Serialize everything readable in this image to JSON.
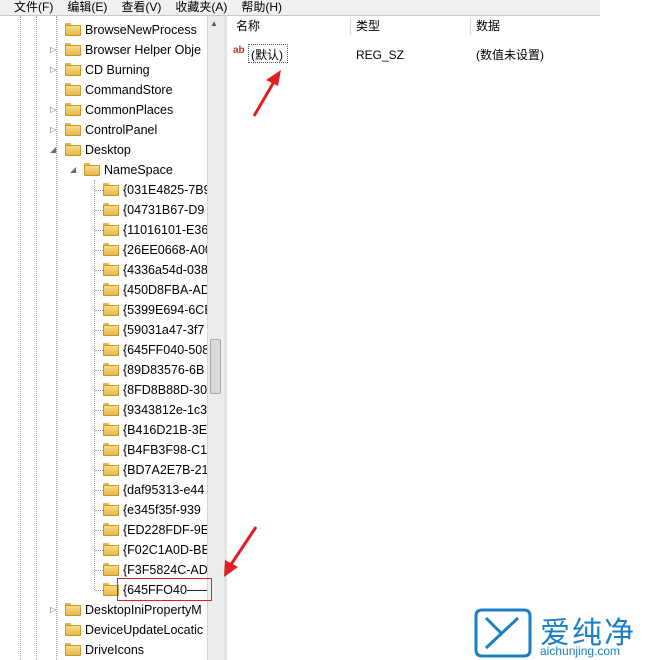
{
  "menu": [
    "文件(F)",
    "编辑(E)",
    "查看(V)",
    "收藏夹(A)",
    "帮助(H)"
  ],
  "columns": {
    "name": "名称",
    "type": "类型",
    "data": "数据"
  },
  "value_row": {
    "name": "(默认)",
    "type": "REG_SZ",
    "data": "(数值未设置)"
  },
  "tree": {
    "top_items": [
      "BrowseNewProcess",
      "Browser Helper Obje",
      "CD Burning",
      "CommandStore",
      "CommonPlaces",
      "ControlPanel"
    ],
    "desktop": "Desktop",
    "namespace": "NameSpace",
    "namespace_items": [
      "{031E4825-7B9",
      "{04731B67-D9",
      "{11016101-E36",
      "{26EE0668-A00",
      "{4336a54d-038",
      "{450D8FBA-AD",
      "{5399E694-6CE",
      "{59031a47-3f7",
      "{645FF040-508",
      "{89D83576-6B",
      "{8FD8B88D-30",
      "{9343812e-1c3",
      "{B416D21B-3E",
      "{B4FB3F98-C1",
      "{BD7A2E7B-21",
      "{daf95313-e44",
      "{e345f35f-939",
      "{ED228FDF-9E",
      "{F02C1A0D-BE",
      "{F3F5824C-AD",
      "{645FFO40——"
    ],
    "bottom_items": [
      "DesktopIniPropertyM",
      "DeviceUpdateLocatic",
      "DriveIcons"
    ]
  },
  "watermark": {
    "brand": "爱纯净",
    "url": "aichunjing.com"
  },
  "colors": {
    "annotation": "#e02020",
    "watermark": "#1a7fc4"
  }
}
